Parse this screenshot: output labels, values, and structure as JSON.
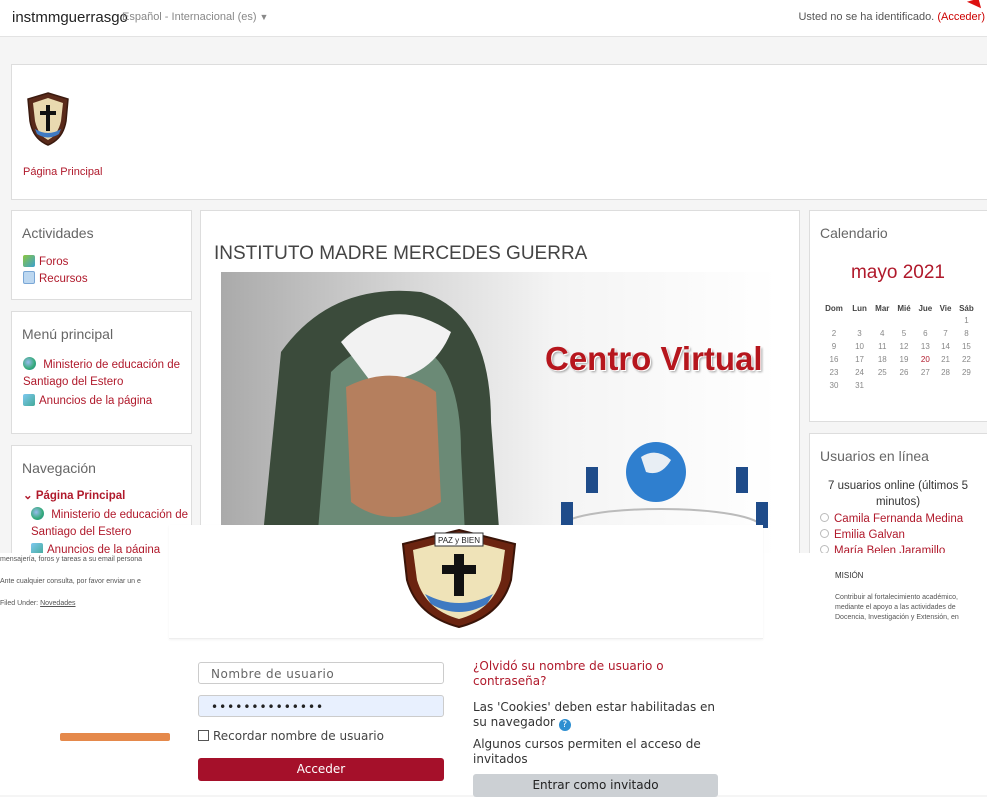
{
  "topbar": {
    "site_name": "instmmguerrasgo",
    "language": "Español - Internacional (es)",
    "login_status": "Usted no se ha identificado.",
    "login_link": "(Acceder)"
  },
  "header": {
    "home_link": "Página Principal"
  },
  "activities": {
    "title": "Actividades",
    "items": [
      {
        "label": "Foros",
        "icon": "forum-icon"
      },
      {
        "label": "Recursos",
        "icon": "resource-icon"
      }
    ]
  },
  "main_menu": {
    "title": "Menú principal",
    "items": [
      {
        "label": "Ministerio de educación de Santiago del Estero",
        "icon": "globe-icon"
      },
      {
        "label": "Anuncios de la página",
        "icon": "chat-icon"
      }
    ]
  },
  "navigation": {
    "title": "Navegación",
    "home": "Página Principal",
    "items": [
      {
        "label": "Ministerio de educación de Santiago del Estero"
      },
      {
        "label": "Anuncios de la página"
      }
    ]
  },
  "main": {
    "title": "INSTITUTO MADRE MERCEDES GUERRA",
    "banner_text": "Centro Virtual"
  },
  "calendar": {
    "title": "Calendario",
    "month": "mayo 2021",
    "weekdays": [
      "Dom",
      "Lun",
      "Mar",
      "Mié",
      "Jue",
      "Vie",
      "Sáb"
    ],
    "weeks": [
      [
        "",
        "",
        "",
        "",
        "",
        "",
        "1"
      ],
      [
        "2",
        "3",
        "4",
        "5",
        "6",
        "7",
        "8"
      ],
      [
        "9",
        "10",
        "11",
        "12",
        "13",
        "14",
        "15"
      ],
      [
        "16",
        "17",
        "18",
        "19",
        "20",
        "21",
        "22"
      ],
      [
        "23",
        "24",
        "25",
        "26",
        "27",
        "28",
        "29"
      ],
      [
        "30",
        "31",
        "",
        "",
        "",
        "",
        ""
      ]
    ],
    "today": "20"
  },
  "online_users": {
    "title": "Usuarios en línea",
    "count_text": "7 usuarios online (últimos 5 minutos)",
    "users": [
      "Camila Fernanda Medina",
      "Emilia Galvan",
      "María Belen Jaramillo"
    ]
  },
  "background_page": {
    "left_lines": [
      "mensajería, foros y tareas a su email persona",
      "Ante cualquier consulta, por favor enviar un e",
      "Filed Under:"
    ],
    "filed_link": "Novedades",
    "right_title": "MISIÓN",
    "right_text": "Contribuir al fortalecimiento académico, mediante el apoyo a las actividades de Docencia, Investigación y Extensión, en"
  },
  "login": {
    "crest_text": "PAZ y BIEN",
    "username_placeholder": "Nombre de usuario",
    "password_value": "••••••••••••••",
    "remember_label": "Recordar nombre de usuario",
    "login_button": "Acceder",
    "forgot_link": "¿Olvidó su nombre de usuario o contraseña?",
    "cookies_text": "Las 'Cookies' deben estar habilitadas en su navegador",
    "guest_info": "Algunos cursos permiten el acceso de invitados",
    "guest_button": "Entrar como invitado"
  },
  "colors": {
    "accent": "#b0192b",
    "login_button": "#a5102a",
    "guest_button": "#ccd0d4"
  }
}
